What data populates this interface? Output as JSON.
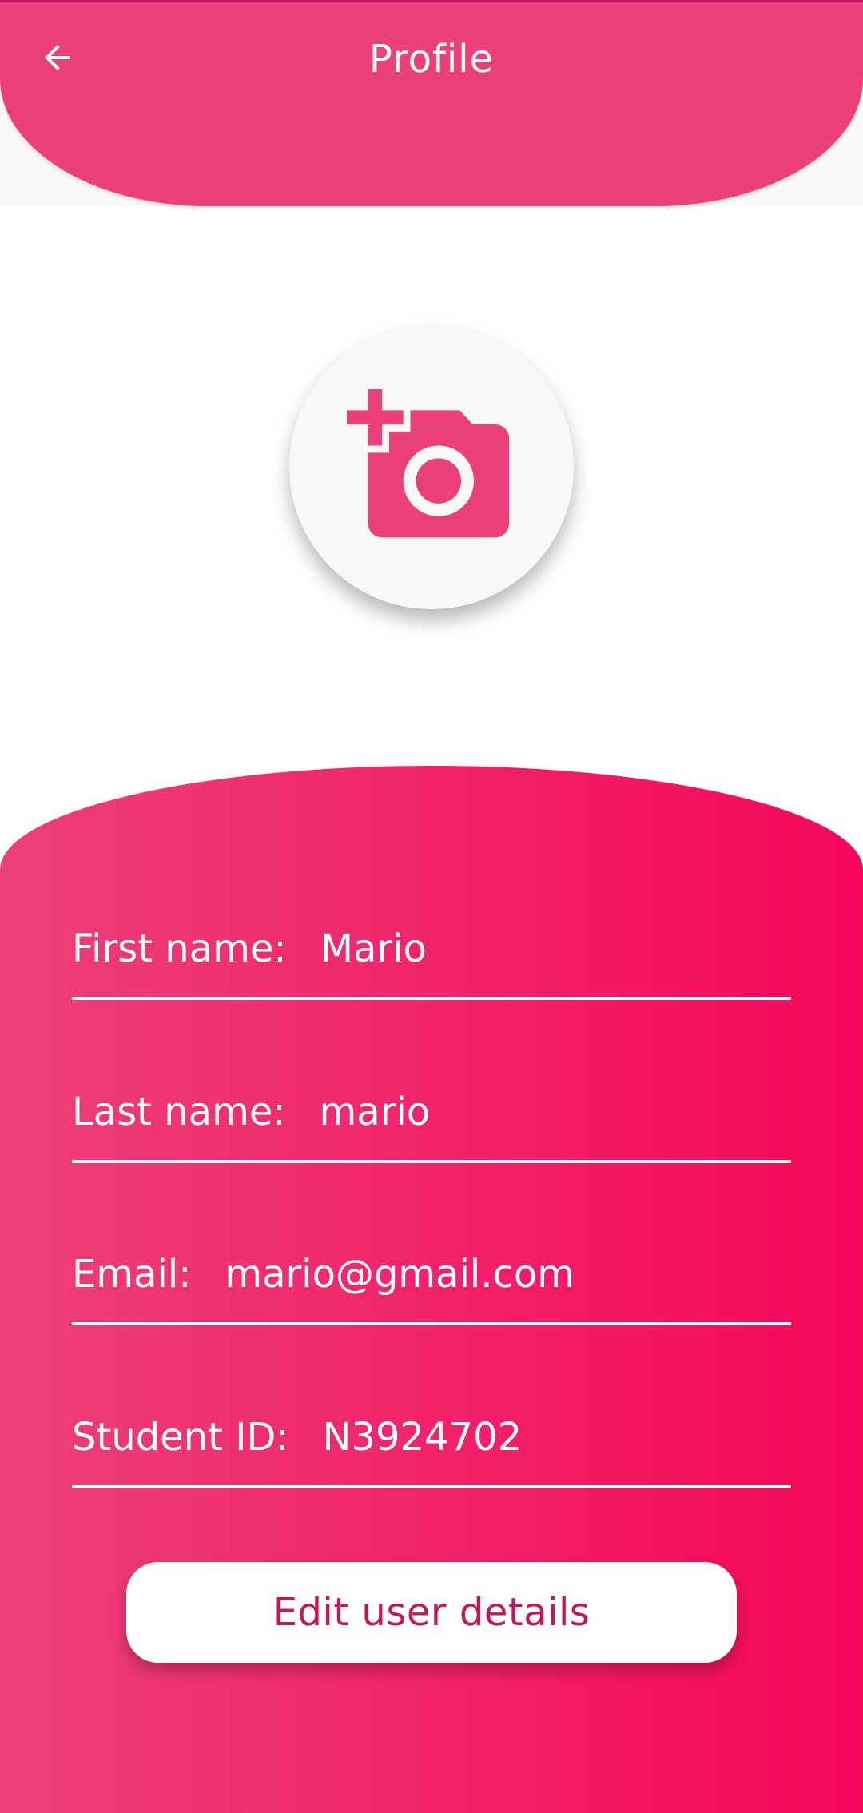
{
  "header": {
    "title": "Profile",
    "back_icon": "arrow-left-icon"
  },
  "avatar": {
    "icon": "add-a-photo-icon"
  },
  "profile": {
    "fields": [
      {
        "label": "First name:",
        "value": "Mario"
      },
      {
        "label": "Last name:",
        "value": "mario"
      },
      {
        "label": "Email:",
        "value": "mario@gmail.com"
      },
      {
        "label": "Student ID:",
        "value": "N3924702"
      }
    ],
    "edit_button_label": "Edit user details"
  },
  "colors": {
    "primary": "#ec407a",
    "accent": "#f5075a",
    "button_text": "#c2185b"
  }
}
